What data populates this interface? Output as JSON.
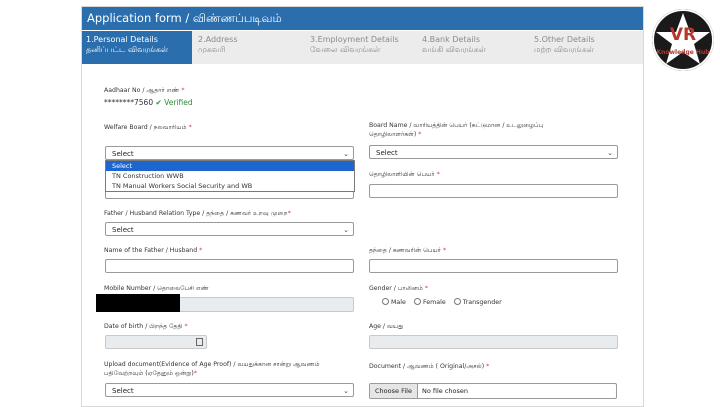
{
  "header": {
    "title": "Application form / விண்ணப்படிவம்"
  },
  "tabs": [
    {
      "line1": "1.Personal Details",
      "line2": "தனிப்பட்ட விவரங்கள்"
    },
    {
      "line1": "2.Address",
      "line2": "முகவரி"
    },
    {
      "line1": "3.Employment Details",
      "line2": "வேலை விவரங்கள்"
    },
    {
      "line1": "4.Bank Details",
      "line2": "வங்கி விவரங்கள்"
    },
    {
      "line1": "5.Other Details",
      "line2": "மற்ற விவரங்கள்"
    }
  ],
  "aadhaar": {
    "label": "Aadhaar No / ஆதார் எண்",
    "value": "********7560",
    "verified": "✔ Verified"
  },
  "welfare_board": {
    "label": "Welfare Board / நலவாரியம்",
    "selected": "Select",
    "options": [
      "Select",
      "TN Construction WWB",
      "TN Manual Workers Social Security and WB"
    ]
  },
  "board_name": {
    "label_line1": "Board Name / வாரியத்தின் பெயர் (கட்டுமான / உடலுழைப்பு",
    "label_line2": "தொழிலாளர்கள்)",
    "selected": "Select"
  },
  "worker_name": {
    "label": "தொழிலாளியின் பெயர்"
  },
  "relation_type": {
    "label": "Father / Husband Relation Type / தந்தை / கணவர் உறவு முறை",
    "selected": "Select"
  },
  "father_name_en": {
    "label": "Name of the Father / Husband"
  },
  "father_name_ta": {
    "label": "தந்தை / கணவரின் பெயர்"
  },
  "mobile": {
    "label": "Mobile Number / தொலைபேசி எண்"
  },
  "gender": {
    "label": "Gender / பாலினம்",
    "options": [
      "Male",
      "Female",
      "Transgender"
    ]
  },
  "dob": {
    "label": "Date of birth / பிறந்த தேதி"
  },
  "age": {
    "label": "Age / வயது"
  },
  "upload_doc": {
    "label_line1": "Upload document(Evidence of Age Proof) / வயதுக்கான சான்று ஆவணம்",
    "label_line2": "பதிவேற்றவும் (ஏதேனும் ஒன்று)",
    "selected": "Select"
  },
  "document": {
    "label": "Document / ஆவணம் ( Original/அசல்)",
    "button": "Choose File",
    "status": "No file chosen"
  },
  "logo": {
    "letters": "VR",
    "subtitle": "Knowledge Hub"
  },
  "colors": {
    "header_blue": "#2a6ead",
    "verified_green": "#2e8b3a",
    "required_red": "#d63a3a",
    "dropdown_highlight": "#1e66cf"
  }
}
